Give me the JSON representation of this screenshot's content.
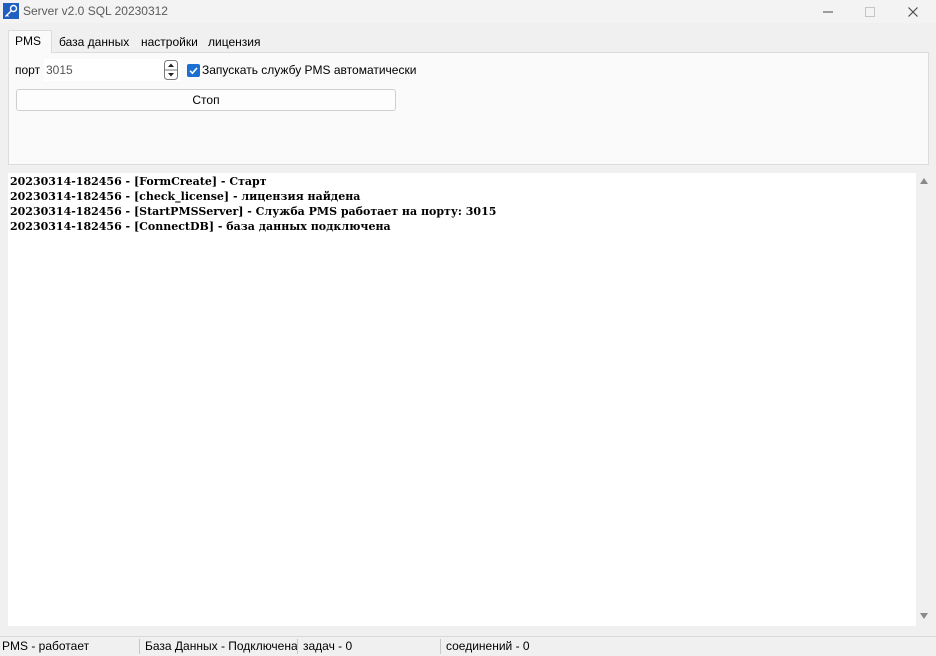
{
  "window": {
    "title": "Server v2.0 SQL 20230312",
    "app_icon": "key-icon"
  },
  "tabs": [
    {
      "label": "PMS",
      "active": true
    },
    {
      "label": "база данных",
      "active": false
    },
    {
      "label": "настройки",
      "active": false
    },
    {
      "label": "лицензия",
      "active": false
    }
  ],
  "pms_panel": {
    "port_label": "порт",
    "port_value": "3015",
    "autostart_checked": true,
    "autostart_label": "Запускать службу PMS автоматически",
    "stop_button": "Стоп"
  },
  "log": [
    "20230314-182456 - [FormCreate] - Старт",
    "20230314-182456 - [check_license] - лицензия найдена",
    "20230314-182456 - [StartPMSServer] - Служба PMS работает на порту: 3015",
    "20230314-182456 - [ConnectDB] - база данных подключена"
  ],
  "statusbar": {
    "pms": "PMS - работает",
    "db": "База Данных - Подключена",
    "tasks": "задач - 0",
    "connections": "соединений - 0"
  },
  "colors": {
    "accent": "#1a6fd0",
    "background": "#f0f0f0",
    "panel": "#fafafa"
  }
}
